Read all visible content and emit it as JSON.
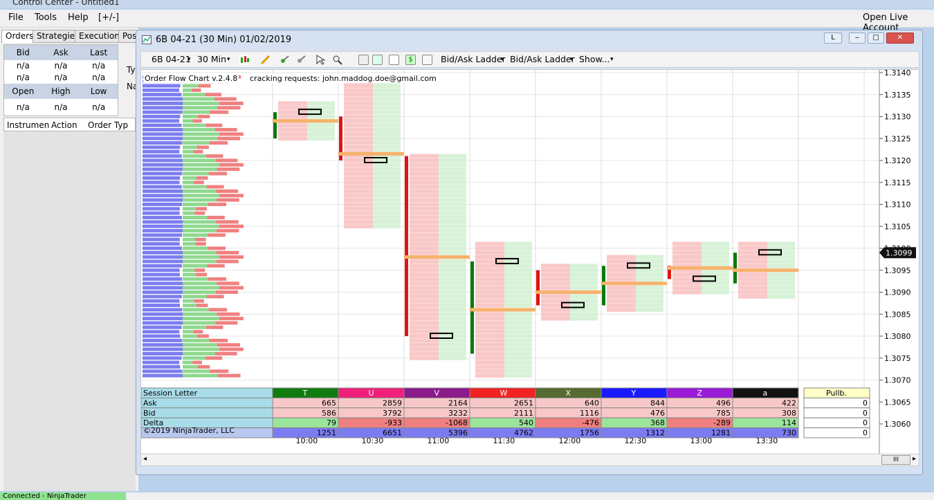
{
  "control_center": {
    "title": "Control Center - Untitled1",
    "menu": [
      "File",
      "Tools",
      "Help",
      "[+/-]"
    ],
    "account_label": "Open Live Account",
    "tabs": [
      "Orders",
      "Strategies",
      "Executions",
      "Pos"
    ],
    "quote_headers_1": [
      "Bid",
      "Ask",
      "Last"
    ],
    "quote_values_1": [
      "n/a",
      "n/a",
      "n/a"
    ],
    "quote_headers_2": [
      "Open",
      "High",
      "Low"
    ],
    "quote_values_2": [
      "n/a",
      "n/a",
      "n/a"
    ],
    "side_labels": [
      "Ty",
      "Na"
    ],
    "order_columns": [
      "Instrumen",
      "Action",
      "Order Typ"
    ],
    "status": "Connected - NinjaTrader Continuum"
  },
  "chart_window": {
    "title": "6B 04-21 (30 Min)  01/02/2019",
    "link_button": "L",
    "toolbar": {
      "instrument": "6B 04-21",
      "interval": "30 Min",
      "ladder_1": "Bid/Ask Ladder",
      "ladder_2": "Bid/Ask Ladder",
      "show": "Show..."
    },
    "indicator_label": "Order Flow Chart v.2.4.8",
    "request_label": "cracking requests: john.maddog.doe@gmail.com",
    "copyright": "©2019 NinjaTrader, LLC",
    "last_price": "1.3099",
    "scroll_button": "III"
  },
  "chart_data": {
    "type": "table",
    "title": "",
    "price_axis": [
      "1.3140",
      "1.3135",
      "1.3130",
      "1.3125",
      "1.3120",
      "1.3115",
      "1.3110",
      "1.3105",
      "1.3100",
      "1.3095",
      "1.3090",
      "1.3085",
      "1.3080",
      "1.3075",
      "1.3070",
      "1.3065",
      "1.3060"
    ],
    "time_axis": [
      "10:00",
      "10:30",
      "11:00",
      "11:30",
      "12:00",
      "12:30",
      "13:00",
      "13:30"
    ],
    "session_table": {
      "row_labels": [
        "Session Letter",
        "Ask",
        "Bid",
        "Delta",
        "Volume"
      ],
      "columns": [
        {
          "letter": "T",
          "ask": "665",
          "bid": "586",
          "delta": "79",
          "volume": "1251",
          "color": "#107c10"
        },
        {
          "letter": "U",
          "ask": "2859",
          "bid": "3792",
          "delta": "-933",
          "volume": "6651",
          "color": "#f01f7a"
        },
        {
          "letter": "V",
          "ask": "2164",
          "bid": "3232",
          "delta": "-1068",
          "volume": "5396",
          "color": "#8b1a8b"
        },
        {
          "letter": "W",
          "ask": "2651",
          "bid": "2111",
          "delta": "540",
          "volume": "4762",
          "color": "#f22222"
        },
        {
          "letter": "X",
          "ask": "640",
          "bid": "1116",
          "delta": "-476",
          "volume": "1756",
          "color": "#556b2f"
        },
        {
          "letter": "Y",
          "ask": "844",
          "bid": "476",
          "delta": "368",
          "volume": "1312",
          "color": "#1a1aff"
        },
        {
          "letter": "Z",
          "ask": "496",
          "bid": "785",
          "delta": "-289",
          "volume": "1281",
          "color": "#9a1ad8"
        },
        {
          "letter": "a",
          "ask": "422",
          "bid": "308",
          "delta": "114",
          "volume": "730",
          "color": "#111111"
        }
      ],
      "pullback": {
        "label": "Pullb.",
        "values": [
          "0",
          "0",
          "0",
          "0"
        ]
      }
    },
    "bars": [
      {
        "time": "10:00",
        "open": 1.3125,
        "high": 1.3133,
        "low": 1.3125,
        "close": 1.3131
      },
      {
        "time": "10:30",
        "open": 1.313,
        "high": 1.3138,
        "low": 1.3105,
        "close": 1.312
      },
      {
        "time": "11:00",
        "open": 1.3121,
        "high": 1.3121,
        "low": 1.3075,
        "close": 1.308
      },
      {
        "time": "11:30",
        "open": 1.3076,
        "high": 1.3101,
        "low": 1.3071,
        "close": 1.3097
      },
      {
        "time": "12:00",
        "open": 1.3095,
        "high": 1.3096,
        "low": 1.3084,
        "close": 1.3087
      },
      {
        "time": "12:30",
        "open": 1.3087,
        "high": 1.3098,
        "low": 1.3086,
        "close": 1.3096
      },
      {
        "time": "13:00",
        "open": 1.3096,
        "high": 1.3101,
        "low": 1.309,
        "close": 1.3093
      },
      {
        "time": "13:30",
        "open": 1.3092,
        "high": 1.3101,
        "low": 1.3089,
        "close": 1.3099
      }
    ],
    "colors": {
      "bull": "#0a7a0a",
      "bear": "#e01414",
      "ask_bg": "#f9c8c8",
      "bid_bg": "#d7f2d7",
      "poc": "#f7b26b",
      "level_yellow": "#ffe36a"
    }
  }
}
